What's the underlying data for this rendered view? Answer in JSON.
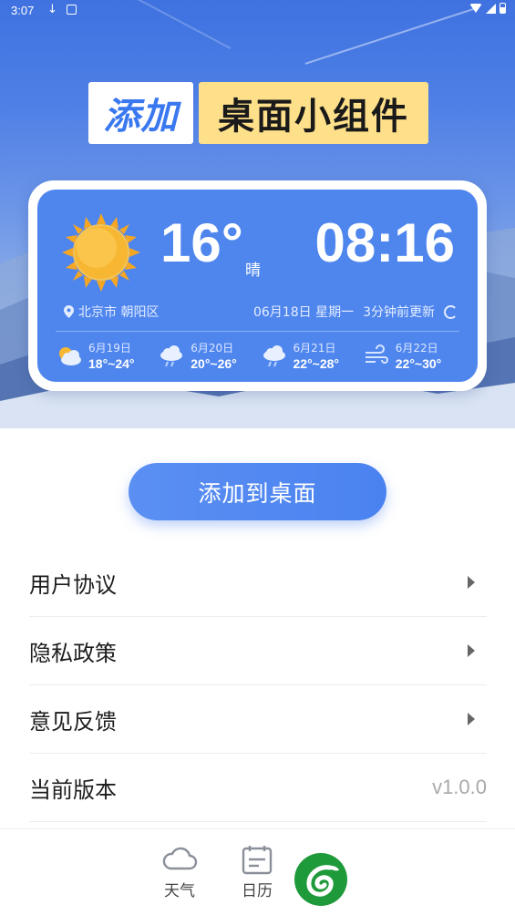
{
  "status_bar": {
    "time": "3:07"
  },
  "title": {
    "left": "添加",
    "right": "桌面小组件"
  },
  "widget": {
    "temperature": "16°",
    "condition": "晴",
    "clock": "08:16",
    "location": "北京市 朝阳区",
    "date": "06月18日 星期一",
    "updated": "3分钟前更新",
    "forecast": [
      {
        "date": "6月19日",
        "range": "18°~24°",
        "icon": "partly-cloudy-icon"
      },
      {
        "date": "6月20日",
        "range": "20°~26°",
        "icon": "rain-cloud-icon"
      },
      {
        "date": "6月21日",
        "range": "22°~28°",
        "icon": "rain-cloud-icon"
      },
      {
        "date": "6月22日",
        "range": "22°~30°",
        "icon": "wind-icon"
      }
    ]
  },
  "add_button": "添加到桌面",
  "menu": {
    "items": [
      {
        "label": "用户协议"
      },
      {
        "label": "隐私政策"
      },
      {
        "label": "意见反馈"
      },
      {
        "label": "当前版本",
        "value": "v1.0.0"
      }
    ]
  },
  "bottom_nav": {
    "weather": "天气",
    "calendar": "日历"
  },
  "colors": {
    "accent": "#4f86ee",
    "badge_yellow": "#ffe08a",
    "sun": "#f7b733"
  }
}
